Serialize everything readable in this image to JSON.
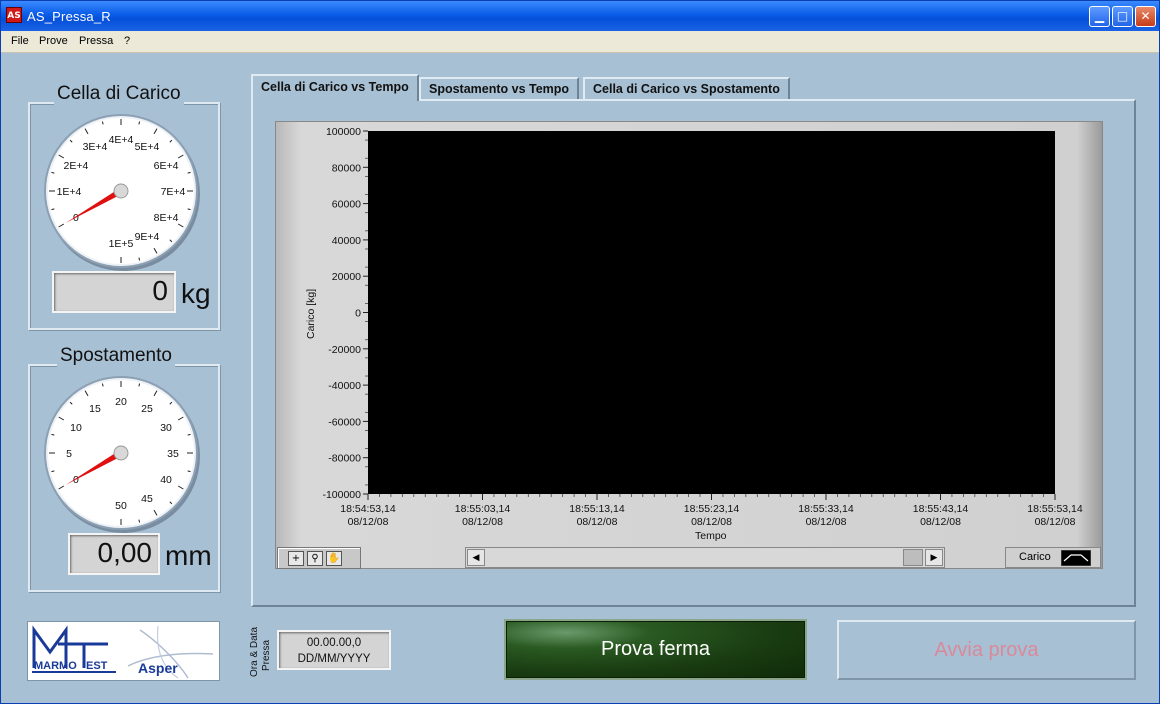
{
  "window": {
    "title": "AS_Pressa_R",
    "icon_text": "AS"
  },
  "menu": [
    "File",
    "Prove",
    "Pressa",
    "?"
  ],
  "load_cell": {
    "title": "Cella di Carico",
    "gauge_labels": [
      "0",
      "1E+4",
      "2E+4",
      "3E+4",
      "4E+4",
      "5E+4",
      "6E+4",
      "7E+4",
      "8E+4",
      "9E+4",
      "1E+5"
    ],
    "value": "0",
    "unit": "kg",
    "needle_fraction": 0
  },
  "displacement": {
    "title": "Spostamento",
    "gauge_labels": [
      "0",
      "5",
      "10",
      "15",
      "20",
      "25",
      "30",
      "35",
      "40",
      "45",
      "50"
    ],
    "value": "0,00",
    "unit": "mm",
    "needle_fraction": 0
  },
  "tabs": [
    {
      "label": "Cella di Carico vs Tempo",
      "active": true
    },
    {
      "label": "Spostamento vs Tempo",
      "active": false
    },
    {
      "label": "Cella di Carico vs Spostamento",
      "active": false
    }
  ],
  "chart_data": {
    "type": "line",
    "xlabel": "Tempo",
    "ylabel": "Carico [kg]",
    "ylim": [
      -100000,
      100000
    ],
    "yticks": [
      "100000",
      "80000",
      "60000",
      "40000",
      "20000",
      "0",
      "-20000",
      "-40000",
      "-60000",
      "-80000",
      "-100000"
    ],
    "xticks": [
      {
        "time": "18:54:53,14",
        "date": "08/12/08"
      },
      {
        "time": "18:55:03,14",
        "date": "08/12/08"
      },
      {
        "time": "18:55:13,14",
        "date": "08/12/08"
      },
      {
        "time": "18:55:23,14",
        "date": "08/12/08"
      },
      {
        "time": "18:55:33,14",
        "date": "08/12/08"
      },
      {
        "time": "18:55:43,14",
        "date": "08/12/08"
      },
      {
        "time": "18:55:53,14",
        "date": "08/12/08"
      }
    ],
    "series": [
      {
        "name": "Carico",
        "values": []
      }
    ],
    "background": "#000000"
  },
  "logo": {
    "marmo": "MARMO",
    "test": "EST",
    "asper": "Asper"
  },
  "timestamp": {
    "label_line1": "Ora & Data",
    "label_line2": "Pressa",
    "time": "00.00.00,0",
    "date": "DD/MM/YYYY"
  },
  "buttons": {
    "stop": "Prova ferma",
    "start": "Avvia prova"
  },
  "colors": {
    "window_bg": "#a8c0d4",
    "plot_bg": "#000000",
    "needle": "#e01010",
    "stop_button": "#1a3d12",
    "start_text": "#d98a9a"
  }
}
